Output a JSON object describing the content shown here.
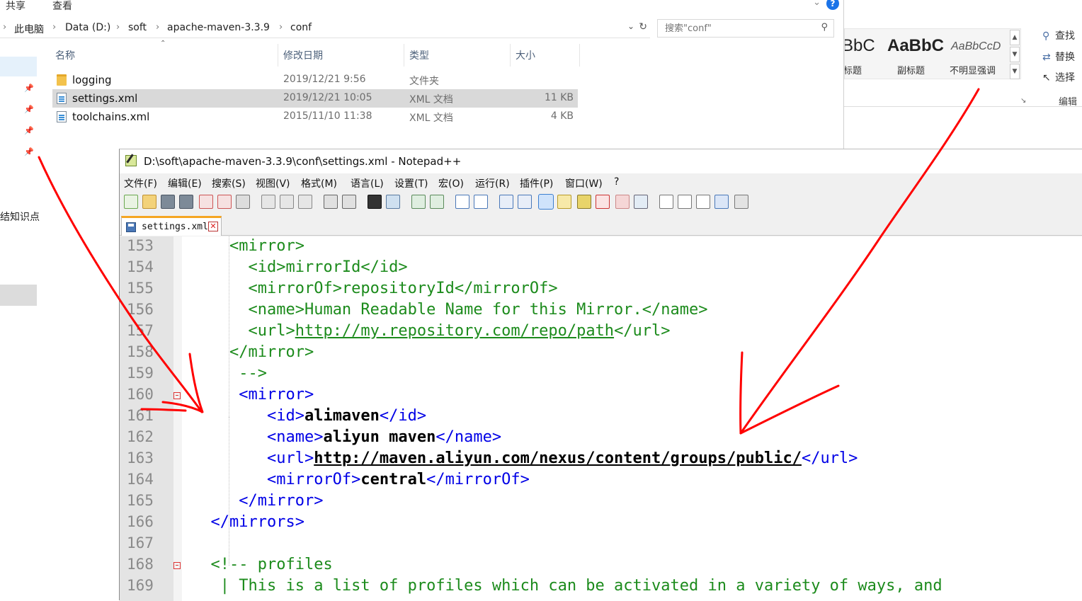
{
  "explorer": {
    "ribbon_tabs": [
      "共享",
      "查看"
    ],
    "breadcrumb": [
      "此电脑",
      "Data (D:)",
      "soft",
      "apache-maven-3.3.9",
      "conf"
    ],
    "search_placeholder": "搜索\"conf\"",
    "columns": {
      "name": "名称",
      "date": "修改日期",
      "type": "类型",
      "size": "大小"
    },
    "files": [
      {
        "name": "logging",
        "date": "2019/12/21 9:56",
        "type": "文件夹",
        "size": "",
        "icon": "folder-icon"
      },
      {
        "name": "settings.xml",
        "date": "2019/12/21 10:05",
        "type": "XML 文档",
        "size": "11 KB",
        "icon": "xml-file-icon",
        "selected": true
      },
      {
        "name": "toolchains.xml",
        "date": "2015/11/10 11:38",
        "type": "XML 文档",
        "size": "4 KB",
        "icon": "xml-file-icon"
      }
    ],
    "nav_fragment_text": "结知识点"
  },
  "word": {
    "styles": [
      {
        "sample": "BbC",
        "name": "标题"
      },
      {
        "sample": "AaBbC",
        "name": "副标题"
      },
      {
        "sample": "AaBbCcD",
        "name": "不明显强调"
      }
    ],
    "edit_commands": [
      "查找",
      "替换",
      "选择"
    ],
    "edit_group_label": "编辑"
  },
  "notepad": {
    "title": "D:\\soft\\apache-maven-3.3.9\\conf\\settings.xml - Notepad++",
    "menu": [
      "文件(F)",
      "编辑(E)",
      "搜索(S)",
      "视图(V)",
      "格式(M)",
      "语言(L)",
      "设置(T)",
      "宏(O)",
      "运行(R)",
      "插件(P)",
      "窗口(W)",
      "?"
    ],
    "tab_name": "settings.xml",
    "lines": [
      {
        "n": "153",
        "indent": "    ",
        "parts": [
          [
            "tg",
            "<mirror>"
          ]
        ]
      },
      {
        "n": "154",
        "indent": "      ",
        "parts": [
          [
            "tg",
            "<id>mirrorId</id>"
          ]
        ]
      },
      {
        "n": "155",
        "indent": "      ",
        "parts": [
          [
            "tg",
            "<mirrorOf>repositoryId</mirrorOf>"
          ]
        ]
      },
      {
        "n": "156",
        "indent": "      ",
        "parts": [
          [
            "tg",
            "<name>Human Readable Name for this Mirror.</name>"
          ]
        ]
      },
      {
        "n": "157",
        "indent": "      ",
        "parts": [
          [
            "tg",
            "<url>"
          ],
          [
            "tg url",
            "http://my.repository.com/repo/path"
          ],
          [
            "tg",
            "</url>"
          ]
        ]
      },
      {
        "n": "158",
        "indent": "    ",
        "parts": [
          [
            "tg",
            "</mirror>"
          ]
        ]
      },
      {
        "n": "159",
        "indent": "     ",
        "parts": [
          [
            "tg",
            "-->"
          ]
        ]
      },
      {
        "n": "160",
        "indent": "     ",
        "parts": [
          [
            "tag",
            "<mirror>"
          ]
        ]
      },
      {
        "n": "161",
        "indent": "        ",
        "parts": [
          [
            "tag",
            "<id>"
          ],
          [
            "bold",
            "alimaven"
          ],
          [
            "tag",
            "</id>"
          ]
        ]
      },
      {
        "n": "162",
        "indent": "        ",
        "parts": [
          [
            "tag",
            "<name>"
          ],
          [
            "bold",
            "aliyun maven"
          ],
          [
            "tag",
            "</name>"
          ]
        ]
      },
      {
        "n": "163",
        "indent": "        ",
        "parts": [
          [
            "tag",
            "<url>"
          ],
          [
            "bold url",
            "http://maven.aliyun.com/nexus/content/groups/public/"
          ],
          [
            "tag",
            "</url>"
          ]
        ]
      },
      {
        "n": "164",
        "indent": "        ",
        "parts": [
          [
            "tag",
            "<mirrorOf>"
          ],
          [
            "bold",
            "central"
          ],
          [
            "tag",
            "</mirrorOf>"
          ]
        ]
      },
      {
        "n": "165",
        "indent": "     ",
        "parts": [
          [
            "tag",
            "</mirror>"
          ]
        ]
      },
      {
        "n": "166",
        "indent": "  ",
        "parts": [
          [
            "tag",
            "</mirrors>"
          ]
        ]
      },
      {
        "n": "167",
        "indent": "",
        "parts": []
      },
      {
        "n": "168",
        "indent": "  ",
        "parts": [
          [
            "cm",
            "<!-- profiles"
          ]
        ]
      },
      {
        "n": "169",
        "indent": "   ",
        "parts": [
          [
            "cm",
            "| This is a list of profiles which can be activated in a variety of ways, and"
          ]
        ]
      }
    ]
  },
  "colors": {
    "annotation_red": "#ff0000",
    "xml_tag_blue": "#0000e6",
    "comment_green": "#1c8b1c"
  }
}
